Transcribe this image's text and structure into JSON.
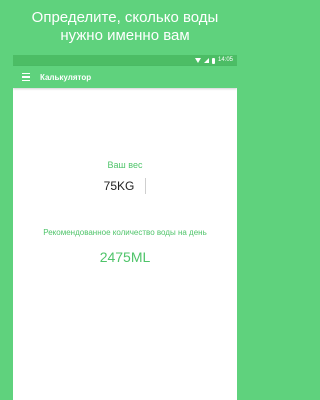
{
  "promo": {
    "line1": "Определите, сколько воды",
    "line2": "нужно именно вам"
  },
  "status_bar": {
    "time": "14:05",
    "icons": [
      "wifi-icon",
      "signal-icon",
      "battery-icon"
    ]
  },
  "app_bar": {
    "menu_icon": "menu-icon",
    "title": "Калькулятор"
  },
  "calculator": {
    "weight_label": "Ваш вес",
    "weight_value": "75KG",
    "recommended_label": "Рекомендованное количество воды на день",
    "recommended_value": "2475ML"
  },
  "colors": {
    "background": "#5fd27d",
    "status_bar": "#4cbd65",
    "accent_text": "#4fc46a"
  }
}
